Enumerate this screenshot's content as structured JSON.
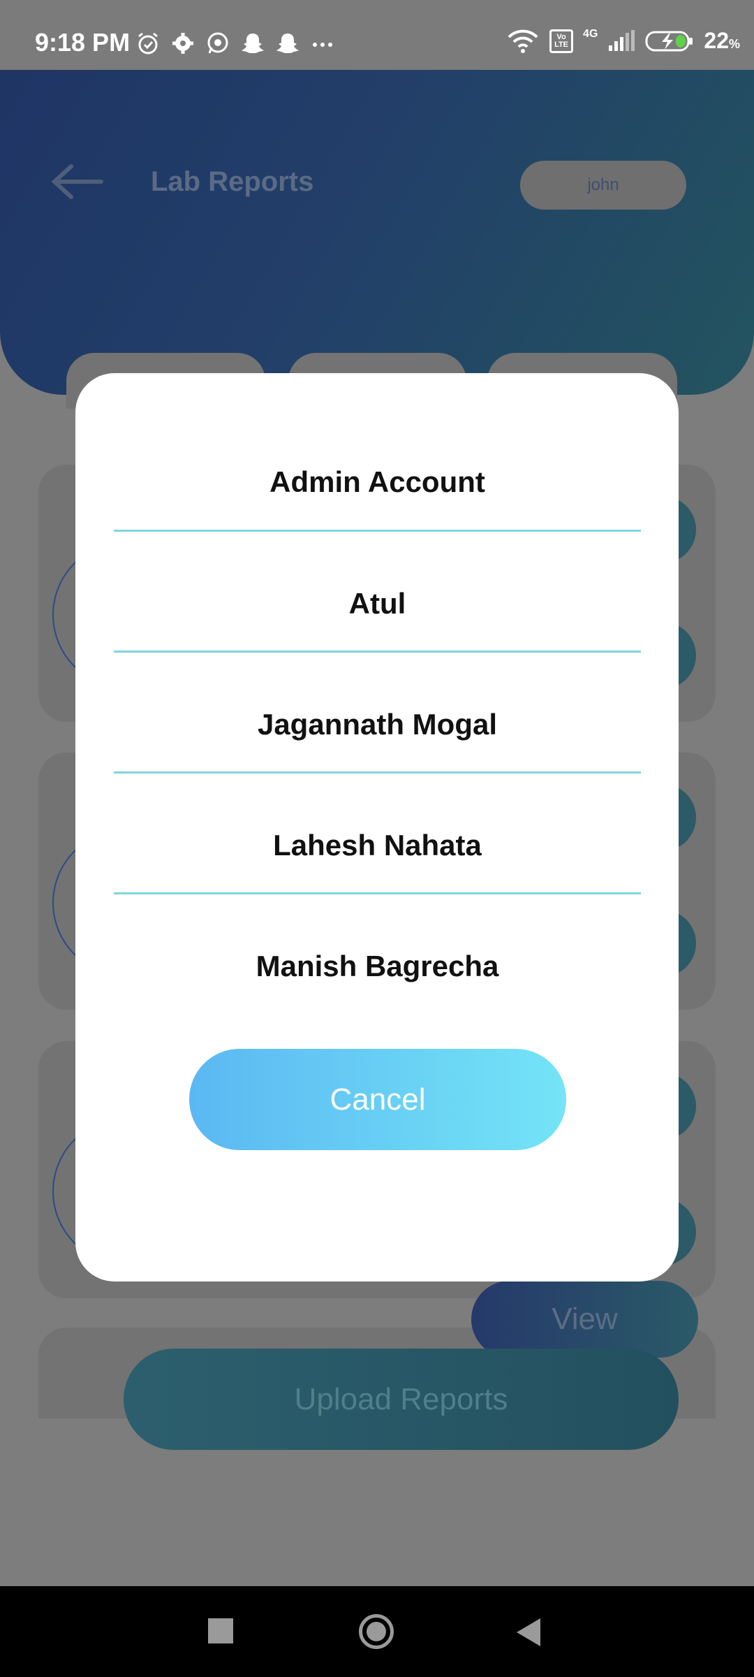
{
  "status_bar": {
    "time": "9:18 PM",
    "battery_percent": "22",
    "battery_unit": "%",
    "network_label": "4G",
    "volte_label": "Vo LTE",
    "icons": [
      "alarm-icon",
      "settings-icon",
      "whatsapp-icon",
      "snapchat-icon",
      "snapchat-icon",
      "more-icon",
      "wifi-icon",
      "signal-icon",
      "battery-charging-icon"
    ]
  },
  "header": {
    "title": "Lab Reports",
    "user_pill": "john"
  },
  "background": {
    "view_label": "View",
    "upload_label": "Upload Reports"
  },
  "dialog": {
    "options": [
      {
        "label": "Admin Account"
      },
      {
        "label": "Atul"
      },
      {
        "label": "Jagannath Mogal"
      },
      {
        "label": "Lahesh Nahata"
      },
      {
        "label": "Manish Bagrecha"
      }
    ],
    "cancel_label": "Cancel"
  },
  "colors": {
    "divider": "#7fd6de",
    "cancel_gradient_start": "#5bb8f2",
    "cancel_gradient_end": "#74e4f6",
    "header_gradient_start": "#1f3565",
    "header_gradient_end": "#23545f"
  }
}
